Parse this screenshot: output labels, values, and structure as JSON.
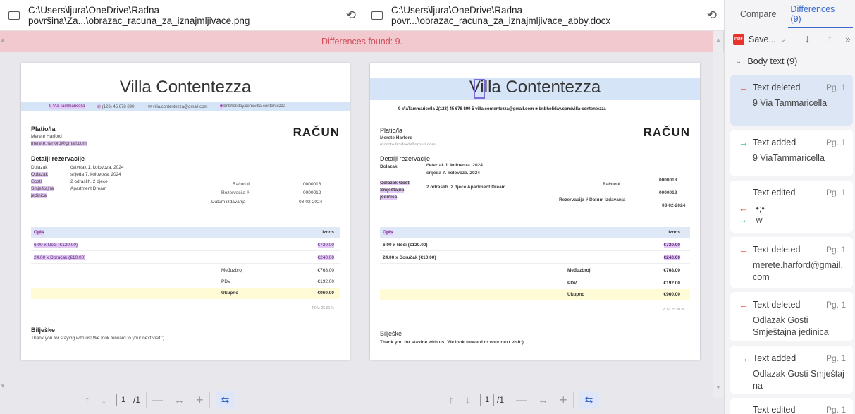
{
  "left_file": {
    "path": "C:\\Users\\ljura\\OneDrive\\Radna površina\\Za...\\obrazac_racuna_za_iznajmljivace.png"
  },
  "right_file": {
    "path": "C:\\Users\\ljura\\OneDrive\\Radna povr...\\obrazac_racuna_za_iznajmljivace_abby.docx"
  },
  "banner": "Differences found: 9.",
  "doc_left": {
    "title": "Villa Contentezza",
    "contact": {
      "address": "9 Via Tammaricella",
      "phone": "(123) 45 678 890",
      "email": "villa.contentezza@gmail.com",
      "web": "bnbholiday.com/villa-contentezza"
    },
    "platio": "Platio/la",
    "name": "Merete Harford",
    "email": "merete.harford@gmail.com",
    "racun": "RAČUN",
    "details_h": "Detalji rezervacije",
    "rows": [
      [
        "Dolazak",
        "četvrtak 1. kolovoza. 2024"
      ],
      [
        "Odlazak",
        "srijeda 7. kolovoza. 2024"
      ],
      [
        "Gosti",
        "2 odraslih, 2 djece"
      ],
      [
        "Smještajna",
        "Apartment Dream"
      ],
      [
        "jedinica",
        ""
      ]
    ],
    "meta": [
      [
        "Račun #",
        "0000018"
      ],
      [
        "Rezervacija #",
        "0000012"
      ],
      [
        "Datum izdavanja",
        "03-02-2024"
      ]
    ],
    "th_opis": "Opis",
    "th_iznos": "Iznos",
    "items": [
      [
        "6.00 x Noći (€120.00)",
        "€720.00"
      ],
      [
        "24.00 x Doručak (€10.00)",
        "€240.00"
      ]
    ],
    "sub": [
      [
        "Međuzbroj",
        "€768.00"
      ],
      [
        "PDV",
        "€192.00"
      ]
    ],
    "total": [
      "Ukupno",
      "€960.00"
    ],
    "pdv_note": "PDV: 25.00 %",
    "notes_h": "Bilješke",
    "notes": "Thank you for staying with us! We look forward to your next visit :)"
  },
  "doc_right": {
    "title": "Villa Contentezza",
    "contact": "9 ViaTammaricella   J(123) 45 678 890 5 villa.contentezza@gmail.com ■ bnbholiday.com/villa-contentezza",
    "platio": "Platio/la",
    "name": "Merete Harford",
    "email_partial": "merete.harford@gmail.com",
    "racun": "RAČUN",
    "details_h": "Detalji rezervacije",
    "rows": [
      [
        "Dolazak",
        "četvrtak 1. kolovoza. 2024"
      ],
      [
        "",
        "srijeda 7. kolovoza. 2024"
      ],
      [
        "Odlazak Gosti",
        "2 odraslih. 2 djece Apartment Dream"
      ],
      [
        "Smještajna",
        ""
      ],
      [
        "jedinica",
        ""
      ]
    ],
    "meta": [
      [
        "Račun #",
        "0000018"
      ],
      [
        "",
        "0000012"
      ],
      [
        "Rezervacija # Datum izdavanja",
        "03-02-2024"
      ]
    ],
    "th_opis": "Opis",
    "th_iznos": "Iznos",
    "items": [
      [
        "6.00 x Noći (€120.00)",
        "€720.00"
      ],
      [
        "24.00 x Doručak (€10.00)",
        "€240.00"
      ]
    ],
    "sub": [
      [
        "Međuzbroj",
        "€768.00"
      ],
      [
        "PDV",
        "€192.00"
      ]
    ],
    "total": [
      "Ukupno",
      "€960.00"
    ],
    "pdv_note": "PDV: 25.00 %",
    "notes_h": "Bilješke",
    "notes": "Thank you for stavine with us! We look forward to vour next visit:)"
  },
  "pager": {
    "page": "1",
    "total": "/1"
  },
  "side": {
    "tab_compare": "Compare",
    "tab_diff": "Differences (9)",
    "save": "Save...",
    "group": "Body text (9)",
    "cards": [
      {
        "type": "Text deleted",
        "pg": "Pg. 1",
        "body": "9 Via Tammaricella"
      },
      {
        "type": "Text added",
        "pg": "Pg. 1",
        "body": "9 ViaTammaricella"
      },
      {
        "type": "Text edited",
        "pg": "Pg. 1",
        "old": "•;•",
        "new": "w"
      },
      {
        "type": "Text deleted",
        "pg": "Pg. 1",
        "body": "merete.harford@gmail.com"
      },
      {
        "type": "Text deleted",
        "pg": "Pg. 1",
        "body": "Odlazak Gosti Smještajna jedinica"
      },
      {
        "type": "Text added",
        "pg": "Pg. 1",
        "body": "Odlazak Gosti Smještajna"
      },
      {
        "type": "Text edited",
        "pg": "Pg. 1"
      }
    ]
  }
}
